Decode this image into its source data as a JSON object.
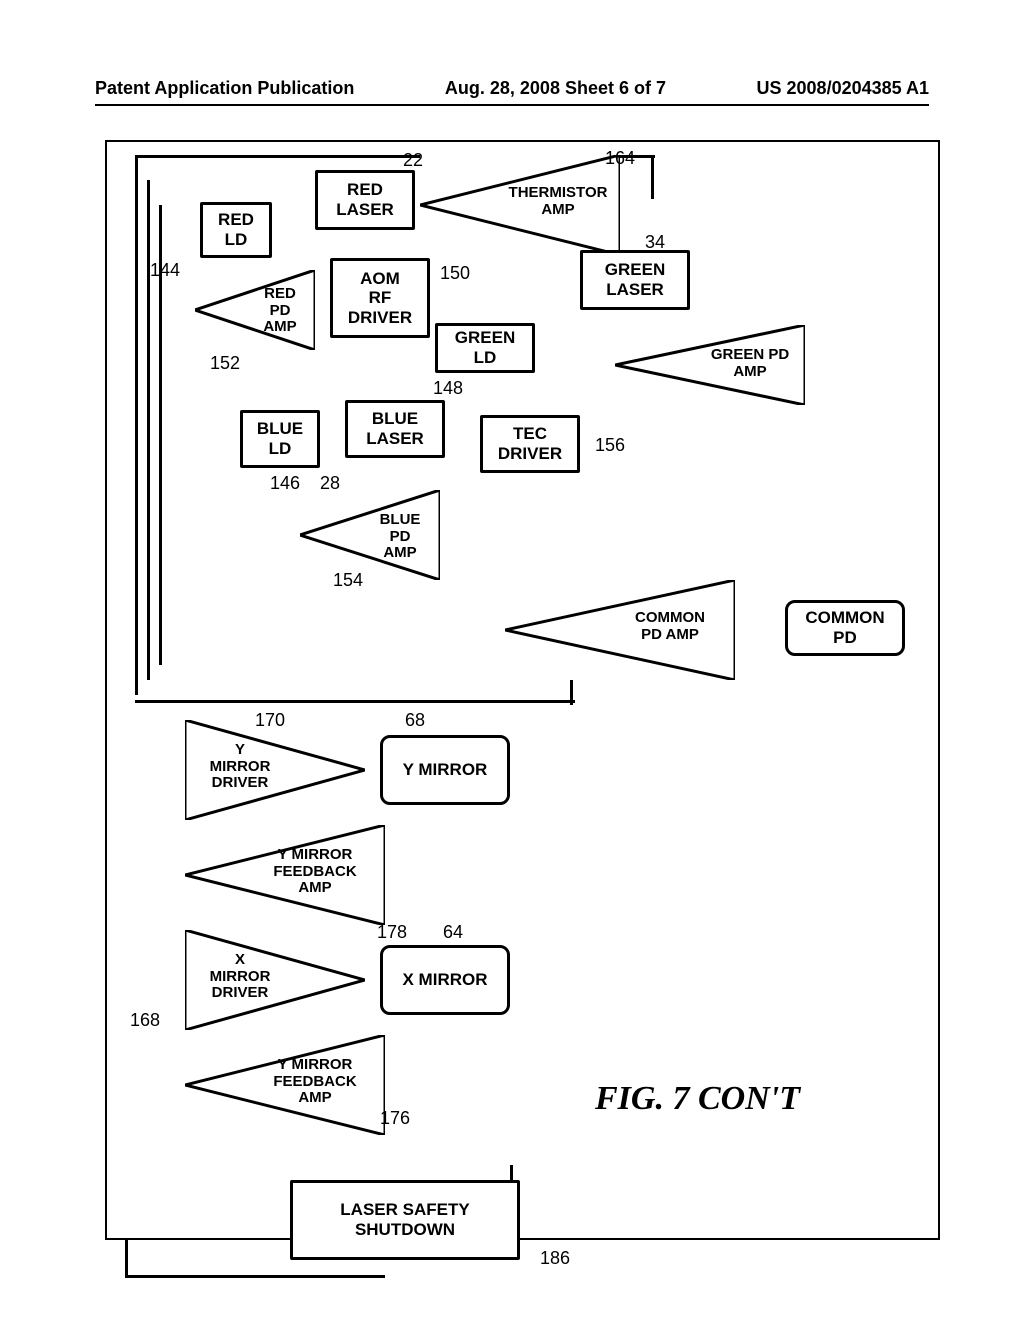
{
  "header": {
    "left": "Patent Application Publication",
    "center": "Aug. 28, 2008   Sheet 6 of 7",
    "right": "US 2008/0204385 A1"
  },
  "blocks": {
    "red_ld": "RED\nLD",
    "red_laser": "RED\nLASER",
    "thermistor_amp": "THERMISTOR\nAMP",
    "green_laser": "GREEN\nLASER",
    "red_pd_amp": "RED\nPD\nAMP",
    "aom_rf_driver": "AOM\nRF\nDRIVER",
    "green_ld": "GREEN\nLD",
    "green_pd_amp": "GREEN PD\nAMP",
    "blue_ld": "BLUE\nLD",
    "blue_laser": "BLUE\nLASER",
    "tec_driver": "TEC\nDRIVER",
    "blue_pd_amp": "BLUE\nPD\nAMP",
    "common_pd_amp": "COMMON\nPD AMP",
    "common_pd": "COMMON\nPD",
    "y_mirror_driver": "Y\nMIRROR\nDRIVER",
    "y_mirror": "Y MIRROR",
    "y_mirror_fb_amp": "Y MIRROR\nFEEDBACK\nAMP",
    "x_mirror_driver": "X\nMIRROR\nDRIVER",
    "x_mirror": "X MIRROR",
    "y_mirror_fb_amp2": "Y MIRROR\nFEEDBACK\nAMP",
    "laser_safety": "LASER SAFETY\nSHUTDOWN"
  },
  "refs": {
    "r22": "22",
    "r164": "164",
    "r34": "34",
    "r144": "144",
    "r150": "150",
    "r152": "152",
    "r148": "148",
    "r156": "156",
    "r146": "146",
    "r28": "28",
    "r154": "154",
    "r170": "170",
    "r68": "68",
    "r178": "178",
    "r64": "64",
    "r168": "168",
    "r176": "176",
    "r186": "186"
  },
  "figure_label": "FIG. 7 CON'T"
}
